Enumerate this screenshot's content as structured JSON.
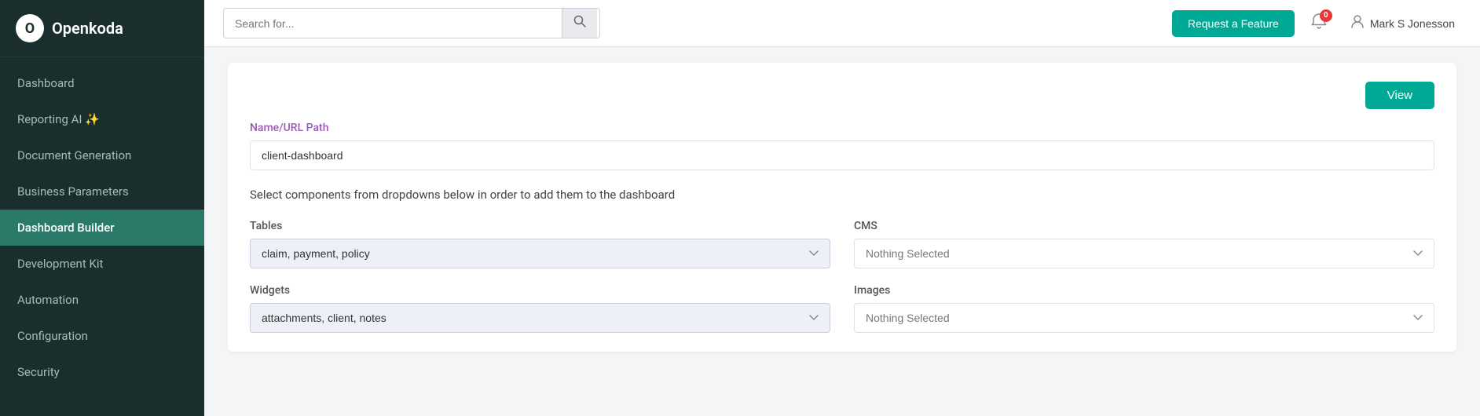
{
  "sidebar": {
    "logo": {
      "icon": "O",
      "text": "Openkoda"
    },
    "items": [
      {
        "id": "dashboard",
        "label": "Dashboard",
        "active": false
      },
      {
        "id": "reporting-ai",
        "label": "Reporting AI ✨",
        "active": false
      },
      {
        "id": "document-generation",
        "label": "Document Generation",
        "active": false
      },
      {
        "id": "business-parameters",
        "label": "Business Parameters",
        "active": false
      },
      {
        "id": "dashboard-builder",
        "label": "Dashboard Builder",
        "active": true
      },
      {
        "id": "development-kit",
        "label": "Development Kit",
        "active": false
      },
      {
        "id": "automation",
        "label": "Automation",
        "active": false
      },
      {
        "id": "configuration",
        "label": "Configuration",
        "active": false
      },
      {
        "id": "security",
        "label": "Security",
        "active": false
      }
    ]
  },
  "header": {
    "search_placeholder": "Search for...",
    "search_icon": "🔍",
    "request_feature_label": "Request a Feature",
    "notification_badge": "0",
    "user_name": "Mark S Jonesson"
  },
  "content": {
    "view_button_label": "View",
    "name_url_label": "Name/URL Path",
    "name_url_value": "client-dashboard",
    "instructions": "Select components from dropdowns below in order to add them to the dashboard",
    "dropdowns": {
      "tables": {
        "label": "Tables",
        "value": "claim, payment, policy",
        "has_value": true
      },
      "cms": {
        "label": "CMS",
        "value": "Nothing Selected",
        "has_value": false
      },
      "widgets": {
        "label": "Widgets",
        "value": "attachments, client, notes",
        "has_value": true
      },
      "images": {
        "label": "Images",
        "value": "Nothing Selected",
        "has_value": false
      }
    }
  }
}
